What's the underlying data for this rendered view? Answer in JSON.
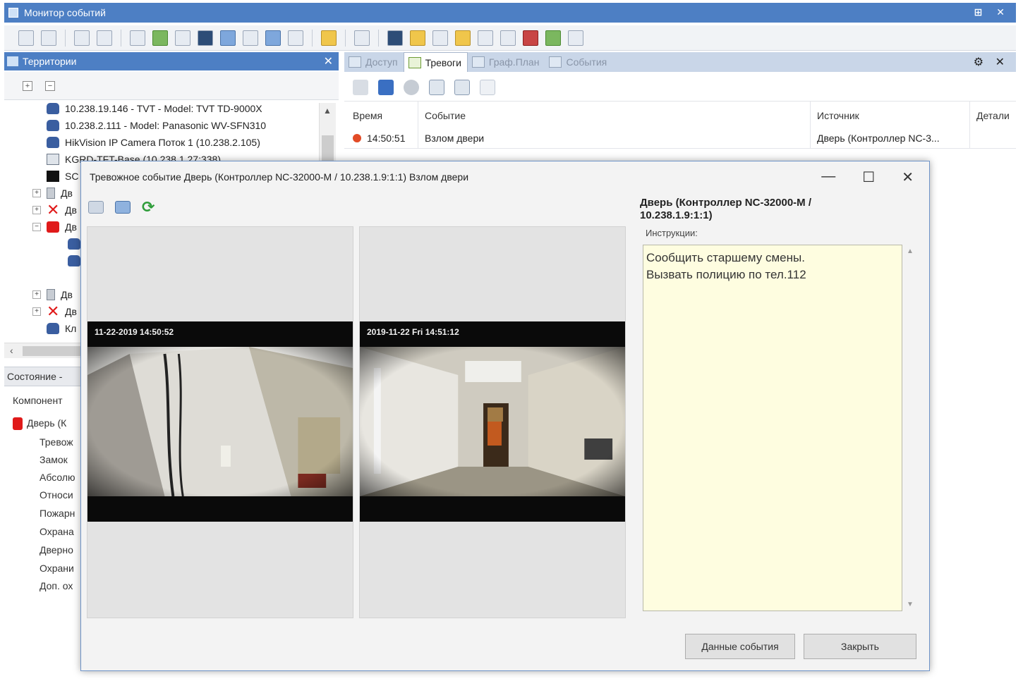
{
  "window": {
    "title": "Монитор событий",
    "controls": "⊞ ✕"
  },
  "territory": {
    "title": "Территории",
    "tree": [
      "10.238.19.146 - TVT - Model: TVT TD-9000X",
      "10.238.2.111 - Model: Panasonic WV-SFN310",
      "HikVision IP Camera Поток 1 (10.238.2.105)",
      "KGRD-TFT-Base (10.238.1.27:338)",
      "SC",
      "Дв",
      "Дв",
      "Дв",
      "Дв",
      "Дв",
      "Кл"
    ]
  },
  "state": {
    "title": "Состояние - ",
    "column": "Компонент",
    "items": [
      "Дверь (К",
      "Тревож",
      "Замок",
      "Абсолю",
      "Относи",
      "Пожарн",
      "Охрана",
      "Дверно",
      "Охрани",
      "Доп. ох"
    ]
  },
  "tabs": [
    {
      "label": "Доступ",
      "active": false
    },
    {
      "label": "Тревоги",
      "active": true
    },
    {
      "label": "Граф.План",
      "active": false
    },
    {
      "label": "События",
      "active": false
    }
  ],
  "tabs_controls": "⚙ ✕",
  "grid": {
    "columns": [
      "Время",
      "Событие",
      "Источник",
      "Детали"
    ],
    "rows": [
      {
        "time": "14:50:51",
        "event": "Взлом двери",
        "source": "Дверь (Контроллер NC-3...",
        "details": ""
      }
    ]
  },
  "dialog": {
    "title": "Тревожное событие Дверь (Контроллер NC-32000-M / 10.238.1.9:1:1) Взлом двери",
    "source": "Дверь (Контроллер NC-32000-M / 10.238.1.9:1:1)",
    "instructions_label": "Инструкции:",
    "instructions": "Сообщить старшему смены.\nВызвать полицию по тел.112",
    "video": [
      {
        "osd": "11-22-2019  14:50:52"
      },
      {
        "osd": "2019-11-22  Fri  14:51:12"
      }
    ],
    "buttons": {
      "event_data": "Данные события",
      "close": "Закрыть"
    }
  }
}
